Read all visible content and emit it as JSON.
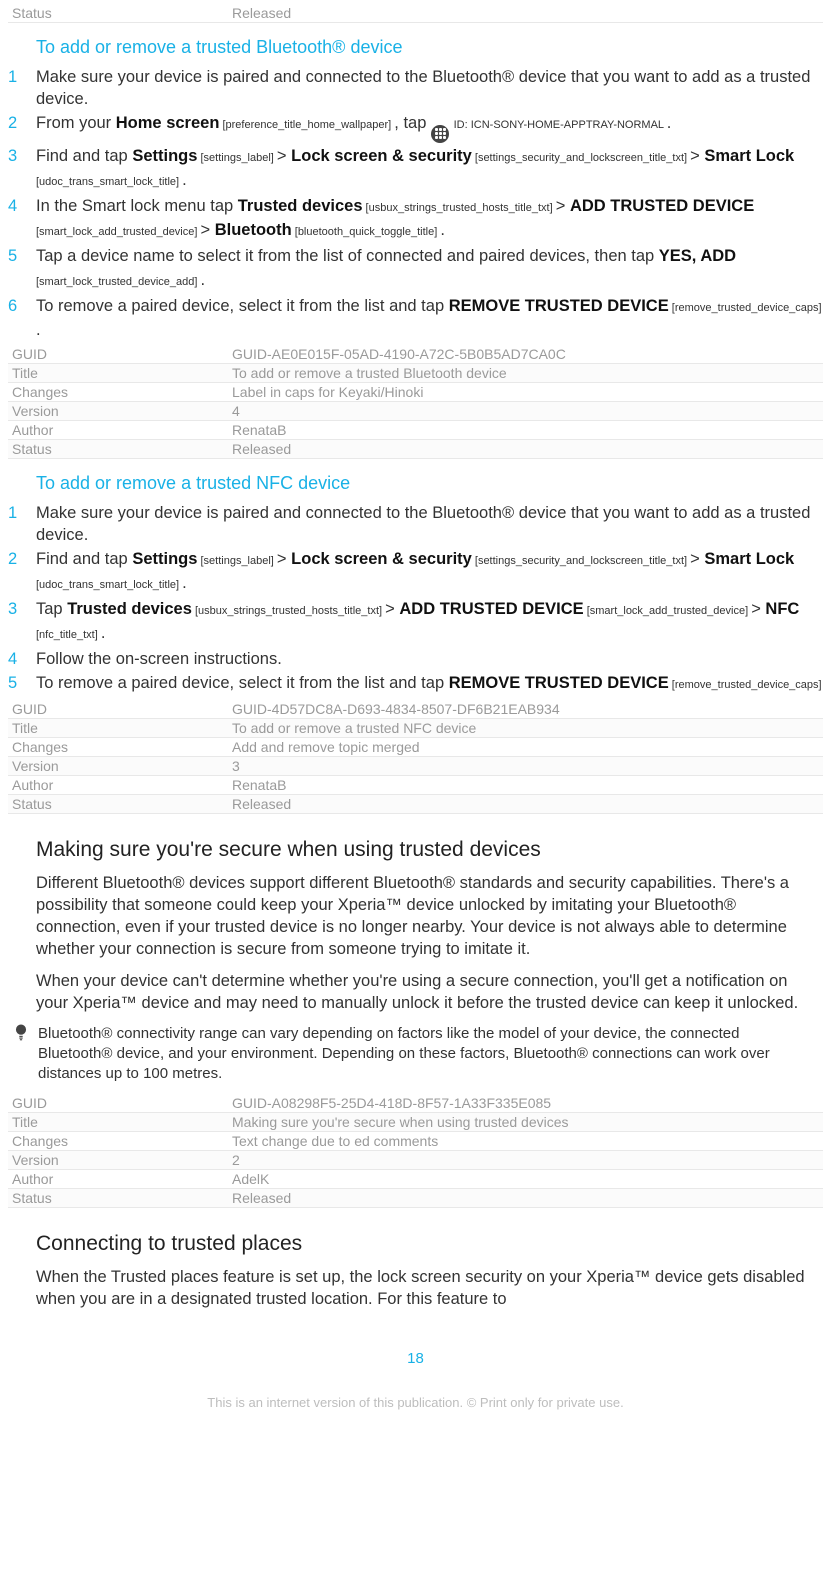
{
  "metaTop": {
    "key": "Status",
    "val": "Released"
  },
  "procA": {
    "heading": "To add or remove a trusted Bluetooth® device",
    "step1": "Make sure your device is paired and connected to the Bluetooth® device that you want to add as a trusted device.",
    "s2_from_your": "From your ",
    "s2_home_screen": "Home screen",
    "s2_ref1": " [preference_title_home_wallpaper] ",
    "s2_tap": ", tap ",
    "s2_idcaps": " ID: ICN-SONY-HOME-APPTRAY-NORMAL ",
    "s2_dot": ".",
    "s3_find_and_tap": "Find and tap ",
    "s3_settings": "Settings",
    "s3_ref_settings": " [settings_label] ",
    "s3_gt": "> ",
    "s3_lss": "Lock screen & security",
    "s3_ref_lss": " [settings_security_and_lockscreen_title_txt] ",
    "s3_smartlock": "Smart Lock",
    "s3_ref_smartlock": " [udoc_trans_smart_lock_title] ",
    "s4_pre": "In the Smart lock menu tap ",
    "s4_td": "Trusted devices",
    "s4_ref_td": " [usbux_strings_trusted_hosts_title_txt] ",
    "s4_add": "ADD TRUSTED DEVICE",
    "s4_ref_add": " [smart_lock_add_trusted_device] ",
    "s4_bt": "Bluetooth",
    "s4_ref_bt": " [bluetooth_quick_toggle_title] ",
    "s5_pre": "Tap a device name to select it from the list of connected and paired devices, then tap ",
    "s5_yesadd": "YES, ADD",
    "s5_ref_yesadd": " [smart_lock_trusted_device_add] ",
    "s6_pre": "To remove a paired device, select it from the list and tap ",
    "s6_rtd": "REMOVE TRUSTED DEVICE",
    "s6_ref_rtd": " [remove_trusted_device_caps] "
  },
  "metaA": {
    "guid_k": "GUID",
    "guid_v": "GUID-AE0E015F-05AD-4190-A72C-5B0B5AD7CA0C",
    "title_k": "Title",
    "title_v": "To add or remove a trusted Bluetooth device",
    "changes_k": "Changes",
    "changes_v": "Label in caps for Keyaki/Hinoki",
    "version_k": "Version",
    "version_v": "4",
    "author_k": "Author",
    "author_v": "RenataB",
    "status_k": "Status",
    "status_v": "Released"
  },
  "procB": {
    "heading": "To add or remove a trusted NFC device",
    "s1": "Make sure your device is paired and connected to the Bluetooth® device that you want to add as a trusted device.",
    "s2_find_and_tap": "Find and tap ",
    "s2_settings": "Settings",
    "s2_ref_settings": " [settings_label] ",
    "s2_lss": "Lock screen & security",
    "s2_ref_lss": " [settings_security_and_lockscreen_title_txt] ",
    "s2_smartlock": "Smart Lock",
    "s2_ref_smartlock": " [udoc_trans_smart_lock_title] ",
    "s3_tap": "Tap ",
    "s3_td": "Trusted devices",
    "s3_ref_td": " [usbux_strings_trusted_hosts_title_txt] ",
    "s3_add": "ADD TRUSTED DEVICE",
    "s3_ref_add": " [smart_lock_add_trusted_device] ",
    "s3_nfc": "NFC",
    "s3_ref_nfc": " [nfc_title_txt] ",
    "s4": "Follow the on-screen instructions.",
    "s5_pre": "To remove a paired device, select it from the list and tap ",
    "s5_rtd": "REMOVE TRUSTED DEVICE",
    "s5_ref_rtd": " [remove_trusted_device_caps]"
  },
  "metaB": {
    "guid_k": "GUID",
    "guid_v": "GUID-4D57DC8A-D693-4834-8507-DF6B21EAB934",
    "title_k": "Title",
    "title_v": "To add or remove a trusted NFC device",
    "changes_k": "Changes",
    "changes_v": "Add and remove topic merged",
    "version_k": "Version",
    "version_v": "3",
    "author_k": "Author",
    "author_v": "RenataB",
    "status_k": "Status",
    "status_v": "Released"
  },
  "sectC": {
    "heading": "Making sure you're secure when using trusted devices",
    "p1": "Different Bluetooth® devices support different Bluetooth® standards and security capabilities. There's a possibility that someone could keep your Xperia™ device unlocked by imitating your Bluetooth® connection, even if your trusted device is no longer nearby. Your device is not always able to determine whether your connection is secure from someone trying to imitate it.",
    "p2": "When your device can't determine whether you're using a secure connection, you'll get a notification on your Xperia™ device and may need to manually unlock it before the trusted device can keep it unlocked.",
    "tip": "Bluetooth® connectivity range can vary depending on factors like the model of your device, the connected Bluetooth® device, and your environment. Depending on these factors, Bluetooth® connections can work over distances up to 100 metres."
  },
  "metaC": {
    "guid_k": "GUID",
    "guid_v": "GUID-A08298F5-25D4-418D-8F57-1A33F335E085",
    "title_k": "Title",
    "title_v": "Making sure you're secure when using trusted devices",
    "changes_k": "Changes",
    "changes_v": "Text change due to ed comments",
    "version_k": "Version",
    "version_v": "2",
    "author_k": "Author",
    "author_v": "AdelK",
    "status_k": "Status",
    "status_v": "Released"
  },
  "sectD": {
    "heading": "Connecting to trusted places",
    "p1": "When the Trusted places feature is set up, the lock screen security on your Xperia™ device gets disabled when you are in a designated trusted location. For this feature to"
  },
  "pageNum": "18",
  "fineprint": "This is an internet version of this publication. © Print only for private use."
}
